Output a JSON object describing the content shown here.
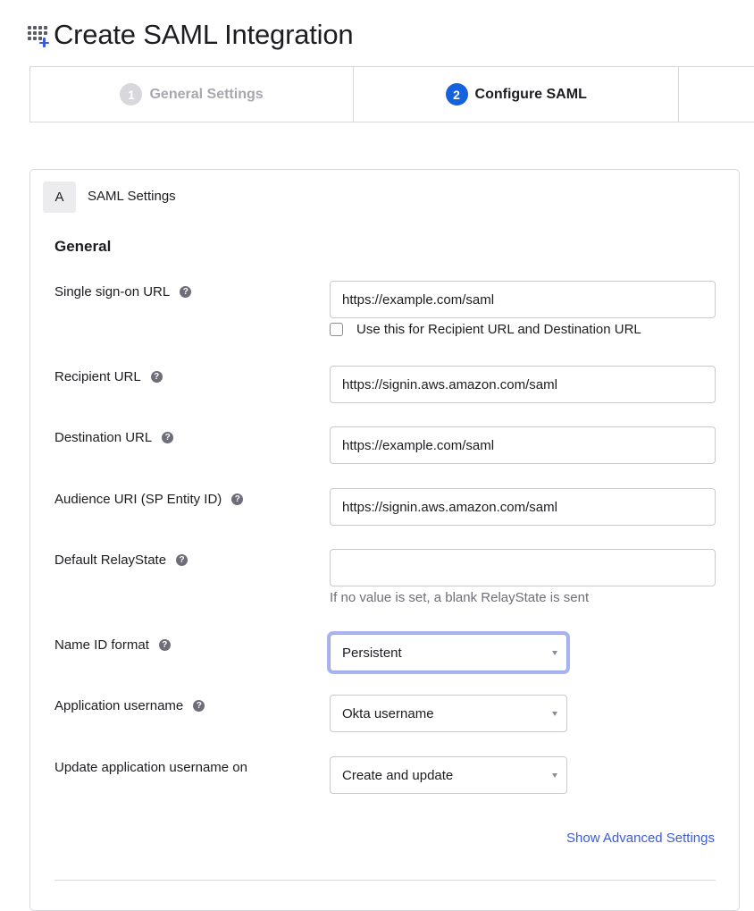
{
  "page": {
    "title": "Create SAML Integration",
    "icon": "app-grid-plus-icon"
  },
  "stepper": {
    "steps": [
      {
        "number": "1",
        "label": "General Settings",
        "state": "completed"
      },
      {
        "number": "2",
        "label": "Configure SAML",
        "state": "active"
      }
    ]
  },
  "section": {
    "badge": "A",
    "title": "SAML Settings",
    "group_title": "General",
    "fields": {
      "sso_url": {
        "label": "Single sign-on URL",
        "value": "https://example.com/saml"
      },
      "use_for_recipient": {
        "label": "Use this for Recipient URL and Destination URL",
        "checked": false
      },
      "recipient_url": {
        "label": "Recipient URL",
        "value": "https://signin.aws.amazon.com/saml"
      },
      "destination_url": {
        "label": "Destination URL",
        "value": "https://example.com/saml"
      },
      "audience_uri": {
        "label": "Audience URI (SP Entity ID)",
        "value": "https://signin.aws.amazon.com/saml"
      },
      "relay_state": {
        "label": "Default RelayState",
        "value": "",
        "hint": "If no value is set, a blank RelayState is sent"
      },
      "name_id_format": {
        "label": "Name ID format",
        "value": "Persistent"
      },
      "app_username": {
        "label": "Application username",
        "value": "Okta username"
      },
      "update_username_on": {
        "label": "Update application username on",
        "value": "Create and update"
      }
    },
    "advanced_link": "Show Advanced Settings"
  },
  "colors": {
    "accent": "#1662dd",
    "link": "#3b5bdb",
    "focus_ring": "#aab4f0",
    "border": "#d7d7dc"
  }
}
